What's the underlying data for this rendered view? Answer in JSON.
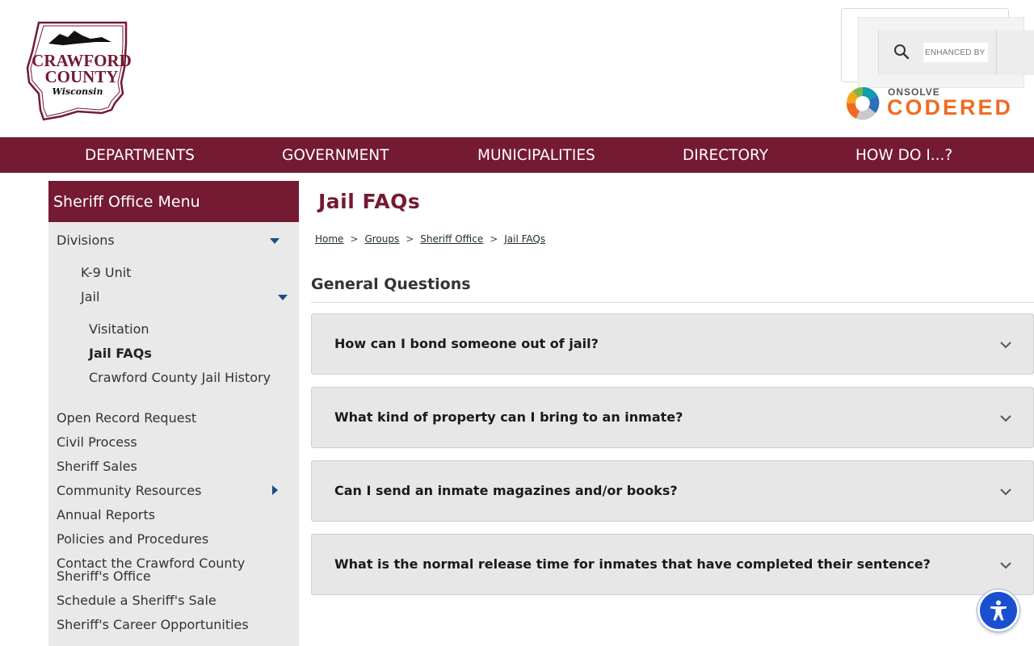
{
  "header": {
    "logo": {
      "line1": "CRAWFORD",
      "line2": "COUNTY",
      "line3": "Wisconsin"
    },
    "search": {
      "placeholder": "ENHANCED BY"
    },
    "codered": {
      "brand": "ONSOLVE",
      "product": "CODERED"
    }
  },
  "nav": {
    "items": [
      {
        "label": "DEPARTMENTS"
      },
      {
        "label": "GOVERNMENT"
      },
      {
        "label": "MUNICIPALITIES"
      },
      {
        "label": "DIRECTORY"
      },
      {
        "label": "HOW DO I...?"
      }
    ]
  },
  "sidebar": {
    "title": "Sheriff Office Menu",
    "divisions": "Divisions",
    "k9": "K-9 Unit",
    "jail": "Jail",
    "visitation": "Visitation",
    "jail_faqs": "Jail FAQs",
    "jail_history": "Crawford County Jail History",
    "items": [
      {
        "label": "Open Record Request"
      },
      {
        "label": "Civil Process"
      },
      {
        "label": "Sheriff Sales"
      },
      {
        "label": "Community Resources"
      },
      {
        "label": "Annual Reports"
      },
      {
        "label": "Policies and Procedures"
      },
      {
        "label": "Contact the Crawford County"
      },
      {
        "label": "Sheriff's Office"
      },
      {
        "label": "Schedule a Sheriff's Sale"
      },
      {
        "label": "Sheriff's Career Opportunities"
      }
    ]
  },
  "main": {
    "title": "Jail FAQs",
    "breadcrumb": {
      "home": "Home",
      "groups": "Groups",
      "sheriff": "Sheriff Office",
      "current": "Jail FAQs",
      "sep": ">"
    },
    "section_title": "General Questions",
    "faqs": [
      {
        "question": "How can I bond someone out of jail?"
      },
      {
        "question": "What kind of property can I bring to an inmate?"
      },
      {
        "question": "Can I send an inmate magazines and/or books?"
      },
      {
        "question": "What is the normal release time for inmates that have completed their sentence?"
      }
    ]
  },
  "colors": {
    "brand_maroon": "#741a33",
    "caret_blue": "#1f4a8a",
    "codered_orange": "#ef6b25",
    "a11y_blue": "#1a4fd0"
  },
  "icons": {
    "search": "search-icon",
    "chevron": "chevron-down-icon",
    "accessibility": "accessibility-icon"
  }
}
